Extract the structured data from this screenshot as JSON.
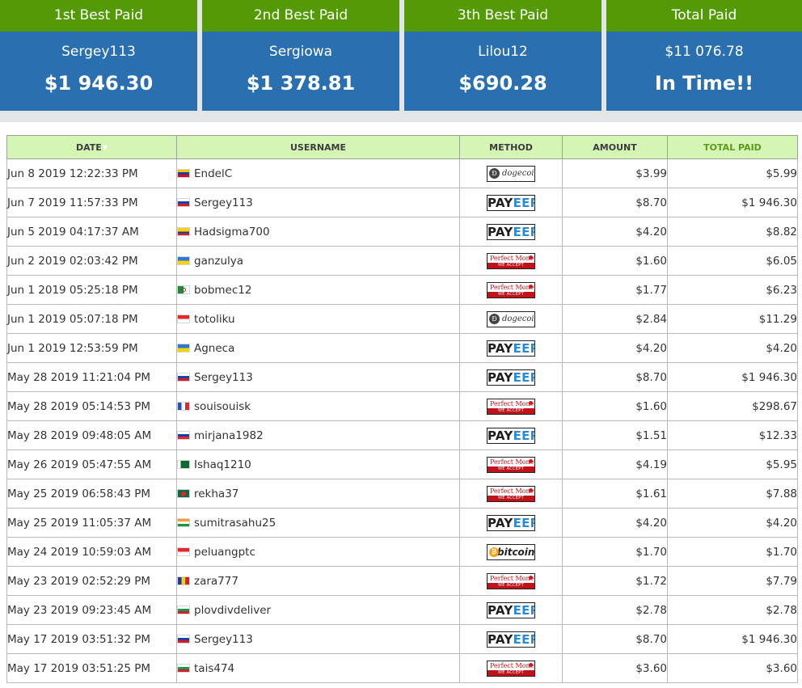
{
  "cards": [
    {
      "heading": "1st Best Paid",
      "name": "Sergey113",
      "value": "$1 946.30"
    },
    {
      "heading": "2nd Best Paid",
      "name": "Sergiowa",
      "value": "$1 378.81"
    },
    {
      "heading": "3th Best Paid",
      "name": "Lilou12",
      "value": "$690.28"
    },
    {
      "heading": "Total Paid",
      "name": "$11 076.78",
      "value": "In Time!!"
    }
  ],
  "table": {
    "headers": {
      "date": "DATE",
      "username": "USERNAME",
      "method": "METHOD",
      "amount": "AMOUNT",
      "total_paid": "TOTAL PAID"
    },
    "sort_icon": "sort-desc-icon",
    "method_labels": {
      "payeer_a": "PAY",
      "payeer_b": "EER",
      "dogecoin": "dogecoin",
      "bitcoin": "bitcoin",
      "pm_top": "Perfect Money",
      "pm_bottom": "WE ACCEPT"
    },
    "rows": [
      {
        "date": "Jun 8 2019 12:22:33 PM",
        "flag": "ve",
        "username": "EndelC",
        "method": "dogecoin",
        "amount": "$3.99",
        "total": "$5.99"
      },
      {
        "date": "Jun 7 2019 11:57:33 PM",
        "flag": "ru",
        "username": "Sergey113",
        "method": "payeer",
        "amount": "$8.70",
        "total": "$1 946.30"
      },
      {
        "date": "Jun 5 2019 04:17:37 AM",
        "flag": "co",
        "username": "Hadsigma700",
        "method": "payeer",
        "amount": "$4.20",
        "total": "$8.82"
      },
      {
        "date": "Jun 2 2019 02:03:42 PM",
        "flag": "ua",
        "username": "ganzulya",
        "method": "perfectmoney",
        "amount": "$1.60",
        "total": "$6.05"
      },
      {
        "date": "Jun 1 2019 05:25:18 PM",
        "flag": "dz",
        "username": "bobmec12",
        "method": "perfectmoney",
        "amount": "$1.77",
        "total": "$6.23"
      },
      {
        "date": "Jun 1 2019 05:07:18 PM",
        "flag": "id",
        "username": "totoliku",
        "method": "dogecoin",
        "amount": "$2.84",
        "total": "$11.29"
      },
      {
        "date": "Jun 1 2019 12:53:59 PM",
        "flag": "ua",
        "username": "Agneca",
        "method": "payeer",
        "amount": "$4.20",
        "total": "$4.20"
      },
      {
        "date": "May 28 2019 11:21:04 PM",
        "flag": "ru",
        "username": "Sergey113",
        "method": "payeer",
        "amount": "$8.70",
        "total": "$1 946.30"
      },
      {
        "date": "May 28 2019 05:14:53 PM",
        "flag": "fr",
        "username": "souisouisk",
        "method": "perfectmoney",
        "amount": "$1.60",
        "total": "$298.67"
      },
      {
        "date": "May 28 2019 09:48:05 AM",
        "flag": "si",
        "username": "mirjana1982",
        "method": "payeer",
        "amount": "$1.51",
        "total": "$12.33"
      },
      {
        "date": "May 26 2019 05:47:55 AM",
        "flag": "pk",
        "username": "Ishaq1210",
        "method": "perfectmoney",
        "amount": "$4.19",
        "total": "$5.95"
      },
      {
        "date": "May 25 2019 06:58:43 PM",
        "flag": "bd",
        "username": "rekha37",
        "method": "perfectmoney",
        "amount": "$1.61",
        "total": "$7.88"
      },
      {
        "date": "May 25 2019 11:05:37 AM",
        "flag": "in",
        "username": "sumitrasahu25",
        "method": "payeer",
        "amount": "$4.20",
        "total": "$4.20"
      },
      {
        "date": "May 24 2019 10:59:03 AM",
        "flag": "id",
        "username": "peluangptc",
        "method": "bitcoin",
        "amount": "$1.70",
        "total": "$1.70"
      },
      {
        "date": "May 23 2019 02:52:29 PM",
        "flag": "ro",
        "username": "zara777",
        "method": "perfectmoney",
        "amount": "$1.72",
        "total": "$7.79"
      },
      {
        "date": "May 23 2019 09:23:45 AM",
        "flag": "bg",
        "username": "plovdivdeliver",
        "method": "payeer",
        "amount": "$2.78",
        "total": "$2.78"
      },
      {
        "date": "May 17 2019 03:51:32 PM",
        "flag": "ru",
        "username": "Sergey113",
        "method": "payeer",
        "amount": "$8.70",
        "total": "$1 946.30"
      },
      {
        "date": "May 17 2019 03:51:25 PM",
        "flag": "bg",
        "username": "tais474",
        "method": "perfectmoney",
        "amount": "$3.60",
        "total": "$3.60"
      }
    ]
  }
}
